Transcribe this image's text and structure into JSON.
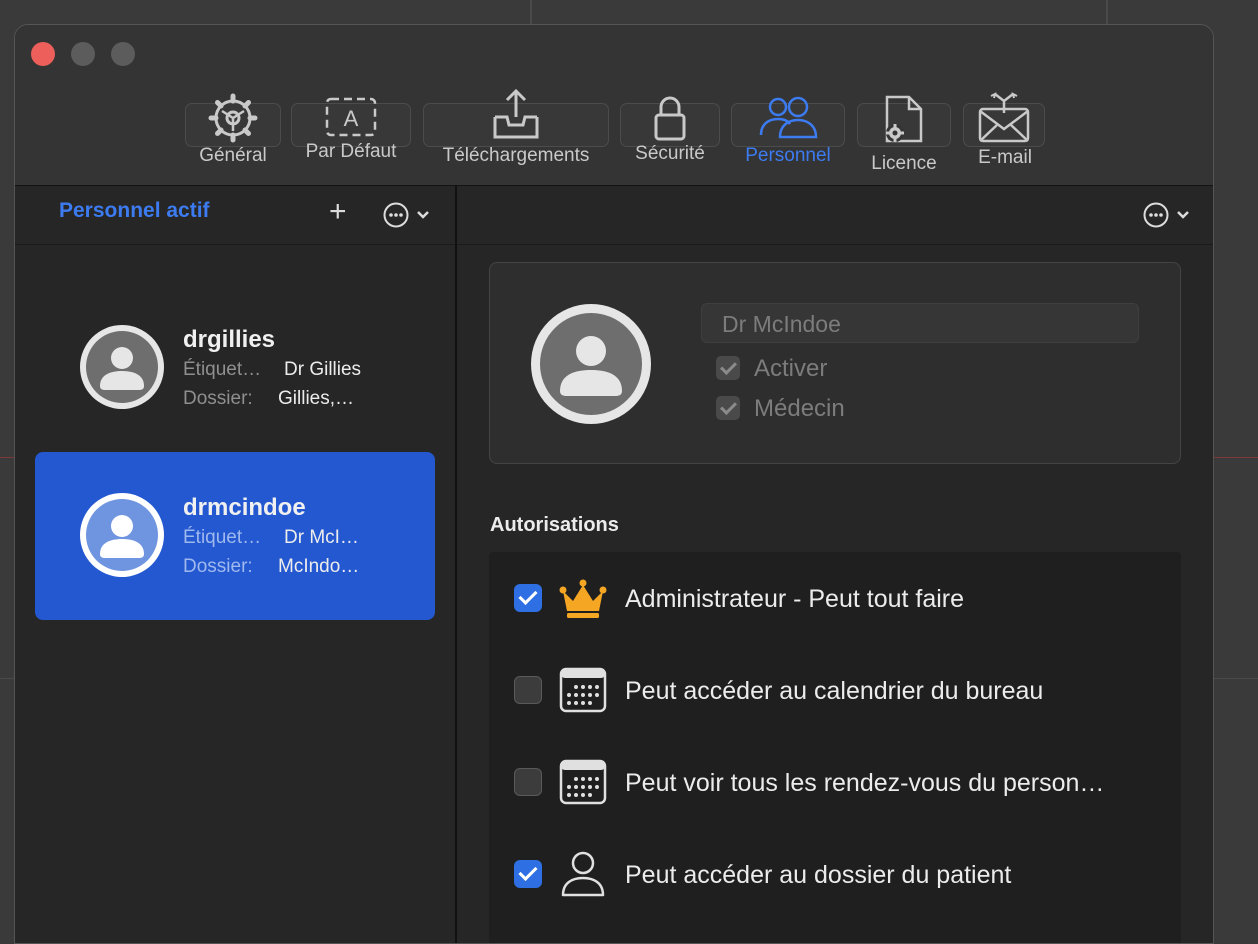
{
  "toolbar": {
    "items": [
      {
        "label": "Général",
        "icon": "gear-icon"
      },
      {
        "label": "Par Défaut",
        "icon": "text-field-icon"
      },
      {
        "label": "Téléchargements",
        "icon": "upload-tray-icon"
      },
      {
        "label": "Sécurité",
        "icon": "lock-icon"
      },
      {
        "label": "Personnel",
        "icon": "people-icon",
        "active": true
      },
      {
        "label": "Licence",
        "icon": "document-gear-icon"
      },
      {
        "label": "E-mail",
        "icon": "envelope-icon"
      }
    ]
  },
  "sidebar": {
    "title": "Personnel actif",
    "add_symbol": "+",
    "people": [
      {
        "username": "drgillies",
        "label_key": "Étiquet…",
        "label_value": "Dr Gillies",
        "folder_key": "Dossier:",
        "folder_value": "Gillies,…",
        "selected": false
      },
      {
        "username": "drmcindoe",
        "label_key": "Étiquet…",
        "label_value": "Dr McI…",
        "folder_key": "Dossier:",
        "folder_value": "McIndo…",
        "selected": true
      }
    ]
  },
  "detail": {
    "name_value": "Dr McIndoe",
    "activate_label": "Activer",
    "activate_checked": true,
    "doctor_label": "Médecin",
    "doctor_checked": true
  },
  "permissions": {
    "title": "Autorisations",
    "items": [
      {
        "label": "Administrateur - Peut tout faire",
        "checked": true,
        "icon": "crown-icon"
      },
      {
        "label": "Peut accéder au calendrier du bureau",
        "checked": false,
        "icon": "calendar-icon"
      },
      {
        "label": "Peut voir tous les rendez-vous du person…",
        "checked": false,
        "icon": "calendar-icon"
      },
      {
        "label": "Peut accéder au dossier du patient",
        "checked": true,
        "icon": "person-icon"
      }
    ]
  },
  "colors": {
    "accent": "#3d7bf0",
    "selection": "#2358d0",
    "crown": "#f5a623"
  }
}
